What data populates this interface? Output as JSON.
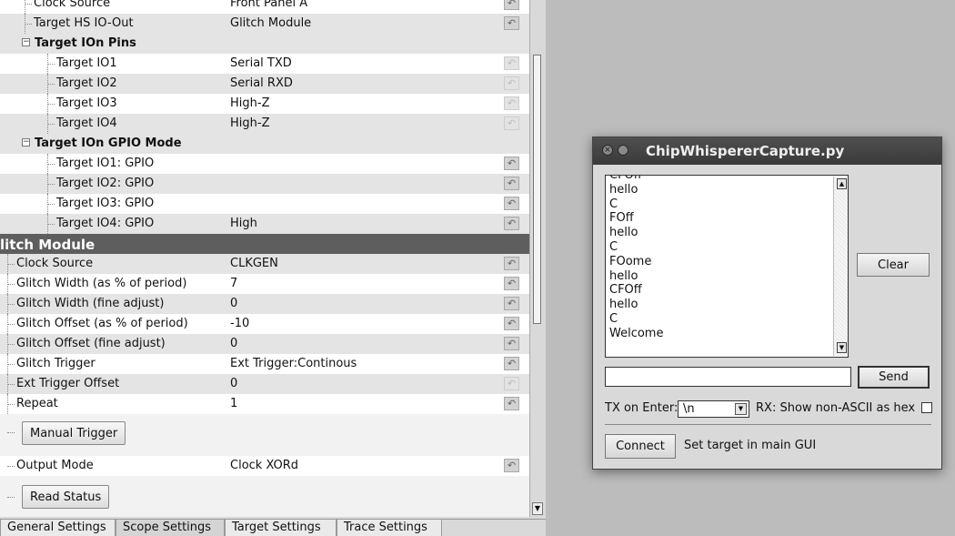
{
  "tree": {
    "rows": [
      {
        "name": "Clock Source",
        "value": "Front Panel A",
        "reset": true,
        "style": "white"
      },
      {
        "name": "Target HS IO-Out",
        "value": "Glitch Module",
        "reset": true,
        "style": "alt"
      },
      {
        "name": "Target IOn Pins",
        "value": "",
        "reset": false,
        "style": "header"
      },
      {
        "name": "Target IO1",
        "value": "Serial TXD",
        "reset": true,
        "dim": true,
        "style": "white"
      },
      {
        "name": "Target IO2",
        "value": "Serial RXD",
        "reset": true,
        "dim": true,
        "style": "alt"
      },
      {
        "name": "Target IO3",
        "value": "High-Z",
        "reset": true,
        "dim": true,
        "style": "white"
      },
      {
        "name": "Target IO4",
        "value": "High-Z",
        "reset": true,
        "dim": true,
        "style": "alt"
      },
      {
        "name": "Target IOn GPIO Mode",
        "value": "",
        "reset": false,
        "style": "header"
      },
      {
        "name": "Target IO1: GPIO",
        "value": "",
        "reset": true,
        "style": "white"
      },
      {
        "name": "Target IO2: GPIO",
        "value": "",
        "reset": true,
        "style": "alt"
      },
      {
        "name": "Target IO3: GPIO",
        "value": "",
        "reset": true,
        "style": "white"
      },
      {
        "name": "Target IO4: GPIO",
        "value": "High",
        "reset": true,
        "style": "alt"
      },
      {
        "name": "litch Module",
        "value": "",
        "reset": false,
        "style": "module-header"
      },
      {
        "name": "Clock Source",
        "value": "CLKGEN",
        "reset": true,
        "style": "alt"
      },
      {
        "name": "Glitch Width (as % of period)",
        "value": "7",
        "reset": true,
        "style": "white"
      },
      {
        "name": "Glitch Width (fine adjust)",
        "value": "0",
        "reset": true,
        "style": "alt"
      },
      {
        "name": "Glitch Offset (as % of period)",
        "value": "-10",
        "reset": true,
        "style": "white"
      },
      {
        "name": "Glitch Offset (fine adjust)",
        "value": "0",
        "reset": true,
        "style": "alt"
      },
      {
        "name": "Glitch Trigger",
        "value": "Ext Trigger:Continous",
        "reset": true,
        "style": "white"
      },
      {
        "name": "Ext Trigger Offset",
        "value": "0",
        "reset": true,
        "dim": true,
        "style": "alt"
      },
      {
        "name": "Repeat",
        "value": "1",
        "reset": true,
        "style": "white"
      }
    ],
    "manual_trigger_label": "Manual Trigger",
    "output_mode": {
      "name": "Output Mode",
      "value": "Clock XORd"
    },
    "read_status_label": "Read Status"
  },
  "tabs": [
    {
      "label": "General Settings",
      "active": false
    },
    {
      "label": "Scope Settings",
      "active": true
    },
    {
      "label": "Target Settings",
      "active": false
    },
    {
      "label": "Trace Settings",
      "active": false
    }
  ],
  "dialog": {
    "title": "ChipWhispererCapture.py",
    "log_lines": [
      "CFOff",
      "hello",
      "C",
      "FOff",
      "hello",
      "C",
      "FOome",
      "hello",
      "CFOff",
      "hello",
      "C",
      "Welcome"
    ],
    "clear_label": "Clear",
    "send_input_value": "",
    "send_label": "Send",
    "tx_label": "TX on Enter:",
    "tx_value": "\\n",
    "rx_label": "RX: Show non-ASCII as hex",
    "rx_hex_checked": false,
    "connect_label": "Connect",
    "status_text": "Set target in main GUI"
  },
  "colors": {
    "module_header_bg": "#5e5e5e",
    "titlebar_bg": "#3a3a3a",
    "desktop_bg": "#bcbcbc"
  }
}
